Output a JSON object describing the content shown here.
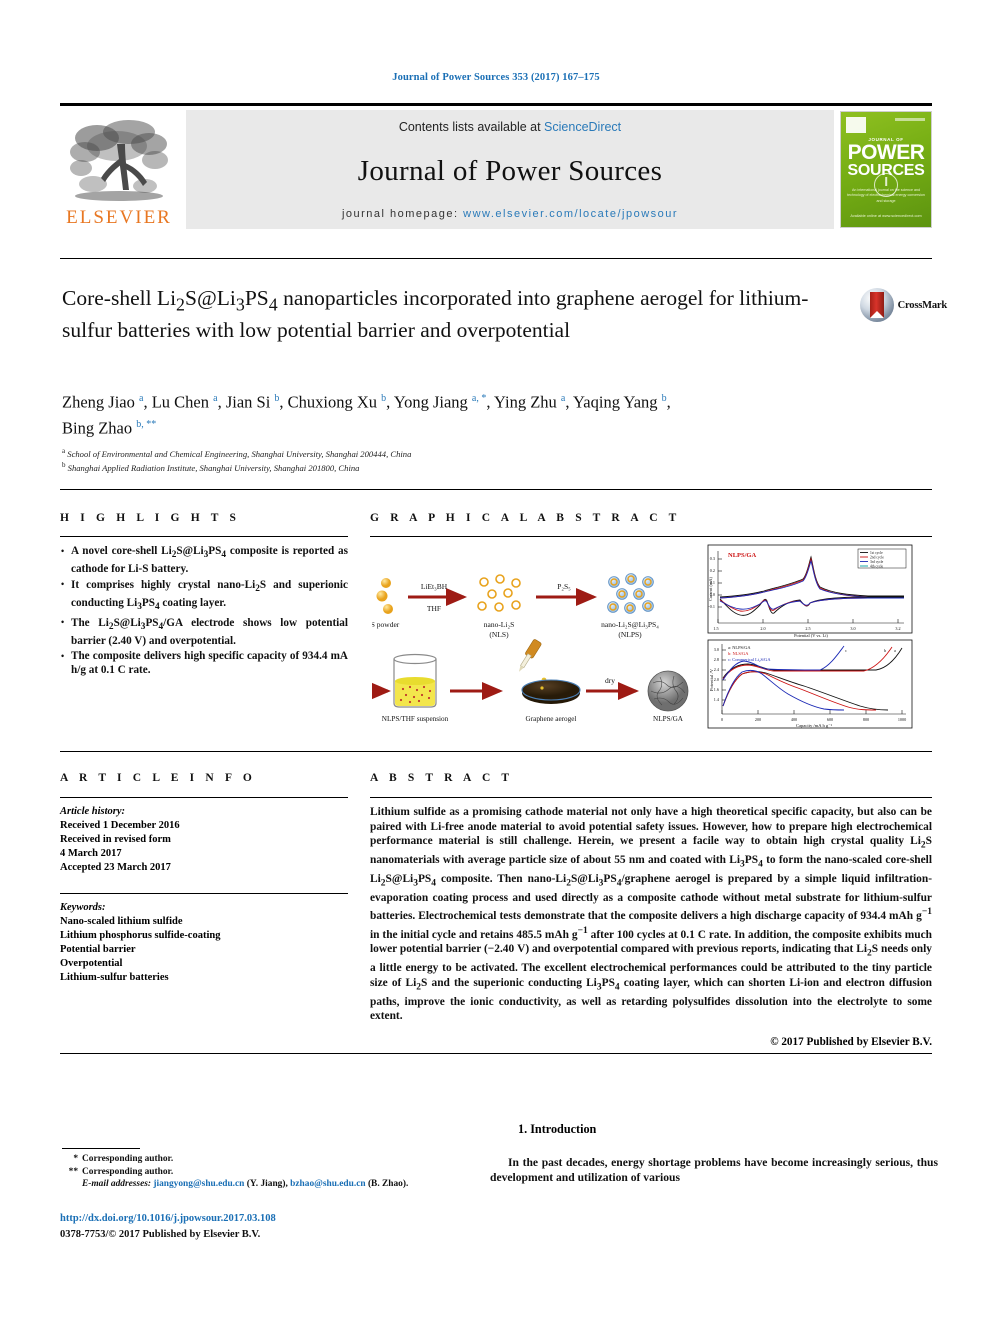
{
  "running_head": "Journal of Power Sources 353 (2017) 167–175",
  "masthead": {
    "contents_prefix": "Contents lists available at ",
    "contents_link": "ScienceDirect",
    "journal_title": "Journal of Power Sources",
    "homepage_prefix": "journal homepage: ",
    "homepage_url": "www.elsevier.com/locate/jpowsour",
    "publisher": "ELSEVIER",
    "cover": {
      "line_small": "JOURNAL OF",
      "line_big_1": "POWER",
      "line_big_2": "SOURCES",
      "subtitle": "An international journal on the science and technology of electrochemical energy conversion and storage",
      "footer": "Available online at www.sciencedirect.com"
    }
  },
  "article": {
    "title": "Core-shell Li2S@Li3PS4 nanoparticles incorporated into graphene aerogel for lithium-sulfur batteries with low potential barrier and overpotential",
    "crossmark_label": "CrossMark",
    "authors": [
      {
        "name": "Zheng Jiao",
        "marks": "a"
      },
      {
        "name": "Lu Chen",
        "marks": "a"
      },
      {
        "name": "Jian Si",
        "marks": "b"
      },
      {
        "name": "Chuxiong Xu",
        "marks": "b"
      },
      {
        "name": "Yong Jiang",
        "marks": "a, *"
      },
      {
        "name": "Ying Zhu",
        "marks": "a"
      },
      {
        "name": "Yaqing Yang",
        "marks": "b"
      },
      {
        "name": "Bing Zhao",
        "marks": "b, **"
      }
    ],
    "affiliations": [
      {
        "mark": "a",
        "text": "School of Environmental and Chemical Engineering, Shanghai University, Shanghai 200444, China"
      },
      {
        "mark": "b",
        "text": "Shanghai Applied Radiation Institute, Shanghai University, Shanghai 201800, China"
      }
    ]
  },
  "highlights": {
    "heading": "H I G H L I G H T S",
    "items": [
      "A novel core-shell Li2S@Li3PS4 composite is reported as cathode for Li-S battery.",
      "It comprises highly crystal nano-Li2S and superionic conducting Li3PS4 coating layer.",
      "The Li2S@Li3PS4/GA electrode shows low potential barrier (2.40 V) and overpotential.",
      "The composite delivers high specific capacity of 934.4 mA h/g at 0.1 C rate."
    ]
  },
  "graphical_abstract": {
    "heading": "G R A P H I C A L   A B S T R A C T",
    "labels": {
      "s_powder": "S powder",
      "reagent1_top": "LiEt3BH",
      "reagent1_bottom": "THF",
      "nano_lis": "nano-Li2S",
      "nano_lis_abbr": "(NLS)",
      "reagent2": "P2S5",
      "nlps": "nano-Li2S@Li3PS4",
      "nlps_abbr": "(NLPS)",
      "thf_label": "THF",
      "suspension": "NLPS/THF suspension",
      "aerogel": "Graphene aerogel",
      "dry": "dry",
      "product": "NLPS/GA"
    },
    "cv_chart": {
      "type": "line",
      "title": "NLPS/GA",
      "xlabel": "Potential (V vs. Li)",
      "ylabel": "Current (mA)",
      "xlim": [
        1.5,
        3.2
      ],
      "ylim": [
        -0.6,
        0.5
      ],
      "xticks": [
        "1.5",
        "2.0",
        "2.5",
        "3.0",
        "3.2"
      ],
      "legend": [
        "1st cycle",
        "2nd cycle",
        "3rd cycle",
        "4th cycle"
      ],
      "legend_colors": [
        "#111111",
        "#cc1111",
        "#1b29b5",
        "#00a0a0"
      ]
    },
    "charge_chart": {
      "type": "line",
      "xlabel": "Capacity /mA h g-1",
      "ylabel": "Potential /V",
      "xlim": [
        0,
        1000
      ],
      "ylim": [
        1.2,
        3.0
      ],
      "xticks": [
        "0",
        "200",
        "400",
        "600",
        "800",
        "1000"
      ],
      "legend": [
        "a: NLPS/GA",
        "b: NLS/GA",
        "c: Commerical Li2S/GA"
      ],
      "legend_colors": [
        "#111111",
        "#cc1111",
        "#1b29b5"
      ]
    }
  },
  "article_info": {
    "heading": "A R T I C L E   I N F O",
    "history_label": "Article history:",
    "history": [
      "Received 1 December 2016",
      "Received in revised form",
      "4 March 2017",
      "Accepted 23 March 2017"
    ],
    "keywords_label": "Keywords:",
    "keywords": [
      "Nano-scaled lithium sulfide",
      "Lithium phosphorus sulfide-coating",
      "Potential barrier",
      "Overpotential",
      "Lithium-sulfur batteries"
    ]
  },
  "abstract": {
    "heading": "A B S T R A C T",
    "text": "Lithium sulfide as a promising cathode material not only have a high theoretical specific capacity, but also can be paired with Li-free anode material to avoid potential safety issues. However, how to prepare high electrochemical performance material is still challenge. Herein, we present a facile way to obtain high crystal quality Li2S nanomaterials with average particle size of about 55 nm and coated with Li3PS4 to form the nano-scaled core-shell Li2S@Li3PS4 composite. Then nano-Li2S@Li3PS4/graphene aerogel is prepared by a simple liquid infiltration-evaporation coating process and used directly as a composite cathode without metal substrate for lithium-sulfur batteries. Electrochemical tests demonstrate that the composite delivers a high discharge capacity of 934.4 mAh g-1 in the initial cycle and retains 485.5 mAh g-1 after 100 cycles at 0.1 C rate. In addition, the composite exhibits much lower potential barrier (~2.40 V) and overpotential compared with previous reports, indicating that Li2S needs only a little energy to be activated. The excellent electrochemical performances could be attributed to the tiny particle size of Li2S and the superionic conducting Li3PS4 coating layer, which can shorten Li-ion and electron diffusion paths, improve the ionic conductivity, as well as retarding polysulfides dissolution into the electrolyte to some extent.",
    "copyright": "© 2017 Published by Elsevier B.V."
  },
  "footnotes": {
    "corresponding_1": "Corresponding author.",
    "corresponding_2": "Corresponding author.",
    "email_label": "E-mail addresses:",
    "email_1": "jiangyong@shu.edu.cn",
    "email_1_who": "(Y. Jiang),",
    "email_2": "bzhao@shu.edu.cn",
    "email_2_who": "(B. Zhao)."
  },
  "doi": "http://dx.doi.org/10.1016/j.jpowsour.2017.03.108",
  "issn_line": "0378-7753/© 2017 Published by Elsevier B.V.",
  "introduction": {
    "heading": "1. Introduction",
    "text": "In the past decades, energy shortage problems have become increasingly serious, thus development and utilization of various"
  },
  "colors": {
    "link": "#1a6fb5",
    "elsevier_orange": "#E87722",
    "cover_green": "#7ab317"
  }
}
